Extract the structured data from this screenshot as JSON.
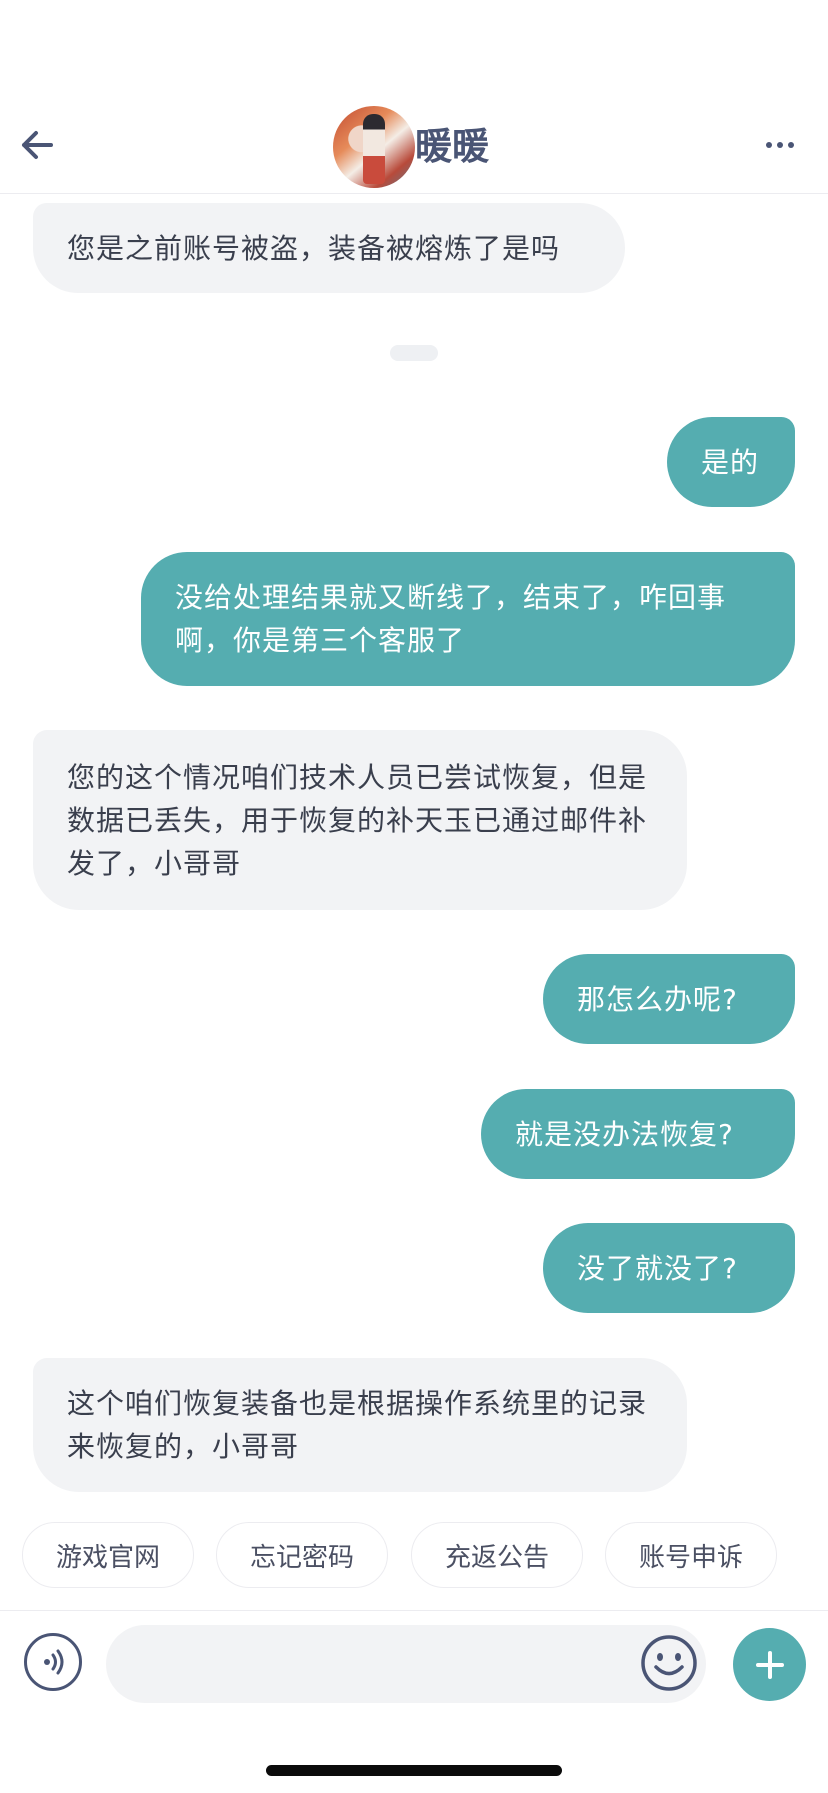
{
  "header": {
    "title": "暖暖",
    "back_icon": "arrow-left-icon",
    "more_icon": "more-dots-icon",
    "avatar": "contact-avatar"
  },
  "messages": [
    {
      "from": "agent",
      "text": "您是之前账号被盗，装备被熔炼了是吗"
    },
    {
      "from": "user",
      "text": "是的"
    },
    {
      "from": "user",
      "text": "没给处理结果就又断线了，结束了，咋回事啊，你是第三个客服了"
    },
    {
      "from": "agent",
      "text": "您的这个情况咱们技术人员已尝试恢复，但是数据已丢失，用于恢复的补天玉已通过邮件补发了，小哥哥"
    },
    {
      "from": "user",
      "text": "那怎么办呢?"
    },
    {
      "from": "user",
      "text": "就是没办法恢复?"
    },
    {
      "from": "user",
      "text": "没了就没了?"
    },
    {
      "from": "agent",
      "text": "这个咱们恢复装备也是根据操作系统里的记录来恢复的，小哥哥"
    }
  ],
  "quick_replies": [
    "游戏官网",
    "忘记密码",
    "充返公告",
    "账号申诉"
  ],
  "input_bar": {
    "placeholder": "",
    "voice_icon": "voice-icon",
    "emoji_icon": "emoji-icon",
    "plus_icon": "plus-icon"
  },
  "colors": {
    "accent": "#55adb0",
    "incoming_bubble": "#f2f3f5",
    "title_text": "#4a5575"
  }
}
